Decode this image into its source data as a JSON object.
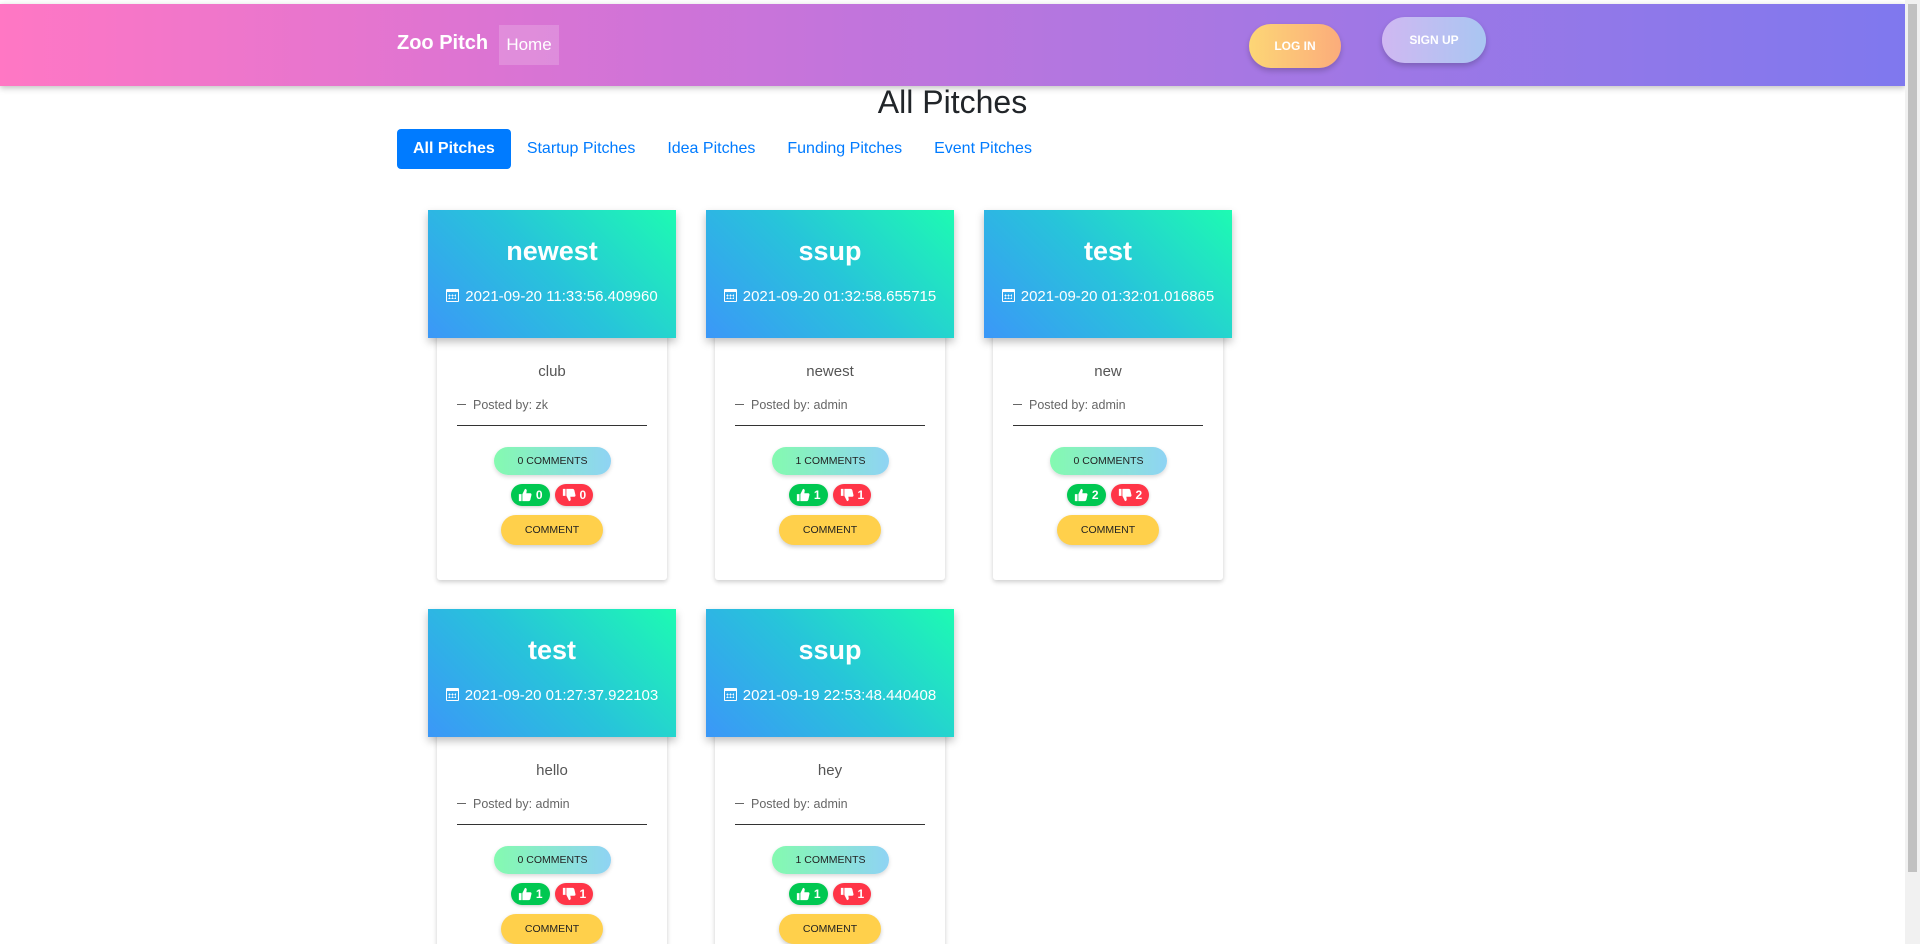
{
  "nav": {
    "brand": "Zoo Pitch",
    "home": "Home",
    "login": "LOG IN",
    "signup": "SIGN UP",
    "colors": {
      "gradient_start": "#ff77c4",
      "gradient_end": "#7f78ee"
    }
  },
  "page_title": "All Pitches",
  "tabs": [
    {
      "label": "All Pitches",
      "active": true
    },
    {
      "label": "Startup Pitches",
      "active": false
    },
    {
      "label": "Idea Pitches",
      "active": false
    },
    {
      "label": "Funding Pitches",
      "active": false
    },
    {
      "label": "Event Pitches",
      "active": false
    }
  ],
  "pitches": [
    {
      "title": "newest",
      "date": "2021-09-20 11:33:56.409960",
      "description": "club",
      "author": "Posted by: zk",
      "comments": "0 COMMENTS",
      "upvotes": "0",
      "downvotes": "0",
      "comment_btn": "COMMENT"
    },
    {
      "title": "ssup",
      "date": "2021-09-20 01:32:58.655715",
      "description": "newest",
      "author": "Posted by: admin",
      "comments": "1 COMMENTS",
      "upvotes": "1",
      "downvotes": "1",
      "comment_btn": "COMMENT"
    },
    {
      "title": "test",
      "date": "2021-09-20 01:32:01.016865",
      "description": "new",
      "author": "Posted by: admin",
      "comments": "0 COMMENTS",
      "upvotes": "2",
      "downvotes": "2",
      "comment_btn": "COMMENT"
    },
    {
      "title": "test",
      "date": "2021-09-20 01:27:37.922103",
      "description": "hello",
      "author": "Posted by: admin",
      "comments": "0 COMMENTS",
      "upvotes": "1",
      "downvotes": "1",
      "comment_btn": "COMMENT"
    },
    {
      "title": "ssup",
      "date": "2021-09-19 22:53:48.440408",
      "description": "hey",
      "author": "Posted by: admin",
      "comments": "1 COMMENTS",
      "upvotes": "1",
      "downvotes": "1",
      "comment_btn": "COMMENT"
    }
  ],
  "icons": {
    "date": "calendar-icon",
    "upvote": "thumbs-up-icon",
    "downvote": "thumbs-down-icon",
    "author": "dash-icon"
  },
  "colors": {
    "upvote": "#00c851",
    "downvote": "#ff3547",
    "comment_button": "#ffd04b",
    "tab_active": "#007bff"
  }
}
